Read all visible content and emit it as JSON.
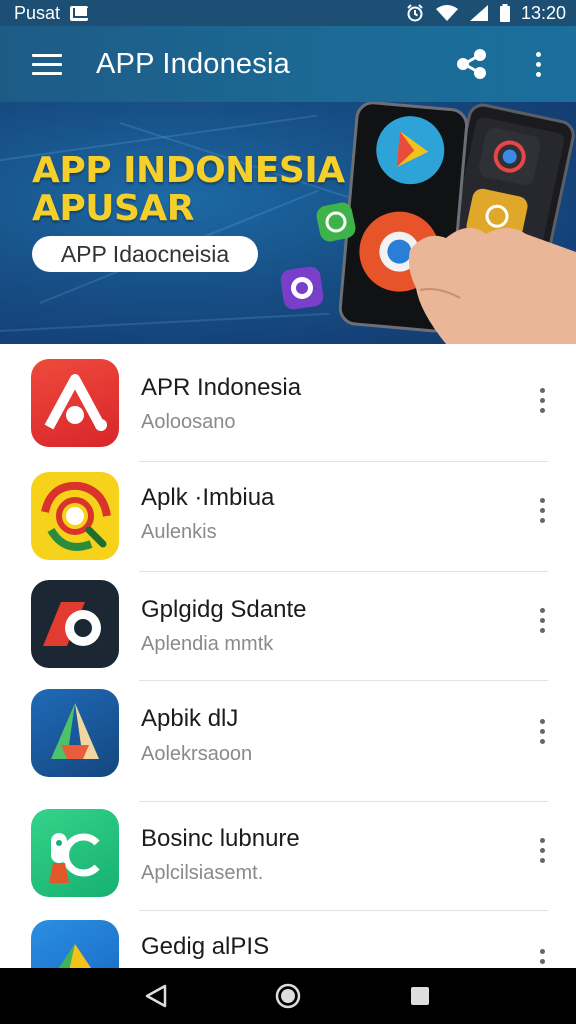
{
  "status_bar": {
    "carrier": "Pusat",
    "time": "13:20",
    "icons": [
      "mail-icon",
      "alarm-icon",
      "wifi-icon",
      "signal-icon",
      "battery-icon"
    ]
  },
  "app_bar": {
    "title": "APP Indonesia",
    "icons": [
      "menu-icon",
      "share-icon",
      "more-vert-icon"
    ]
  },
  "banner": {
    "title_line1": "APP INDONESIA",
    "title_line2": "APUSAR",
    "pill_text": "APP Idaocneisia",
    "colors": {
      "title": "#f5cf2a",
      "background": "#174f86"
    }
  },
  "apps": [
    {
      "title": "APR Indonesia",
      "subtitle": "Aoloosano",
      "icon": "app-icon-red-a"
    },
    {
      "title": "Aplk ·Imbiua",
      "subtitle": "Aulenkis",
      "icon": "app-icon-yellow-swirl"
    },
    {
      "title": "Gplgidg Sdante",
      "subtitle": "Aplendia mmtk",
      "icon": "app-icon-dark-ring"
    },
    {
      "title": "Apbik dlJ",
      "subtitle": "Aolekrsaoon",
      "icon": "app-icon-blue-a"
    },
    {
      "title": "Bosinc lubnure",
      "subtitle": "Aplcilsiasemt.",
      "icon": "app-icon-green-c"
    },
    {
      "title": "Gedig alPIS",
      "subtitle": "",
      "icon": "app-icon-blue-triangle"
    }
  ],
  "nav_bar": {
    "icons": [
      "back-icon",
      "home-icon",
      "recents-icon"
    ]
  }
}
